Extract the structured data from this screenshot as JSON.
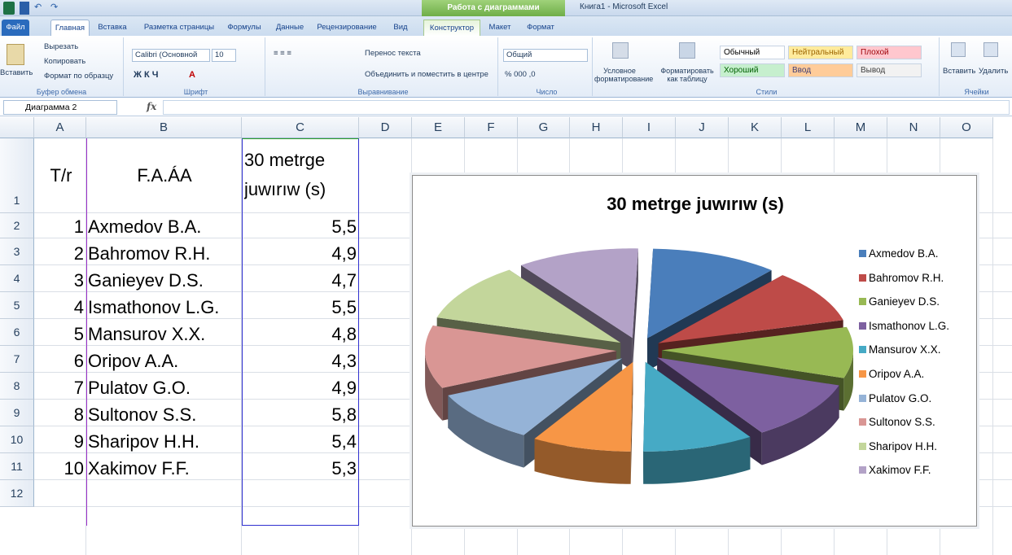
{
  "app": {
    "window_title": "Книга1 - Microsoft Excel",
    "context_tab_group": "Работа с диаграммами"
  },
  "ribbon": {
    "tabs": [
      "Файл",
      "Главная",
      "Вставка",
      "Разметка страницы",
      "Формулы",
      "Данные",
      "Рецензирование",
      "Вид",
      "Конструктор",
      "Макет",
      "Формат"
    ],
    "clipboard": {
      "paste": "Вставить",
      "cut": "Вырезать",
      "copy": "Копировать",
      "format_painter": "Формат по образцу",
      "label": "Буфер обмена"
    },
    "font": {
      "name": "Calibri (Основной",
      "size": "10",
      "label": "Шрифт"
    },
    "alignment": {
      "wrap": "Перенос текста",
      "merge": "Объединить и поместить в центре",
      "label": "Выравнивание"
    },
    "number": {
      "format": "Общий",
      "label": "Число"
    },
    "styles": {
      "conditional": "Условное форматирование",
      "as_table": "Форматировать как таблицу",
      "cells": [
        "Обычный",
        "Нейтральный",
        "Плохой",
        "Хороший",
        "Ввод",
        "Вывод"
      ],
      "label": "Стили"
    },
    "cells_group": {
      "insert": "Вставить",
      "delete": "Удалить",
      "label": "Ячейки"
    }
  },
  "formula_bar": {
    "name_box": "Диаграмма 2",
    "fx": "fx",
    "value": ""
  },
  "sheet": {
    "columns": [
      "A",
      "B",
      "C",
      "D",
      "E",
      "F",
      "G",
      "H",
      "I",
      "J",
      "K",
      "L",
      "M",
      "N",
      "O"
    ],
    "rows": [
      "1",
      "2",
      "3",
      "4",
      "5",
      "6",
      "7",
      "8",
      "9",
      "10",
      "11",
      "12"
    ],
    "header": {
      "a": "T/r",
      "b": "F.A.ÁA",
      "c1": "30 metrge",
      "c2": "juwırıw (s)"
    },
    "data": [
      {
        "n": "1",
        "name": "Axmedov B.A.",
        "val": "5,5"
      },
      {
        "n": "2",
        "name": "Bahromov R.H.",
        "val": "4,9"
      },
      {
        "n": "3",
        "name": "Ganieyev D.S.",
        "val": "4,7"
      },
      {
        "n": "4",
        "name": "Ismathonov L.G.",
        "val": "5,5"
      },
      {
        "n": "5",
        "name": "Mansurov X.X.",
        "val": "4,8"
      },
      {
        "n": "6",
        "name": "Oripov A.A.",
        "val": "4,3"
      },
      {
        "n": "7",
        "name": "Pulatov G.O.",
        "val": "4,9"
      },
      {
        "n": "8",
        "name": "Sultonov S.S.",
        "val": "5,8"
      },
      {
        "n": "9",
        "name": "Sharipov H.H.",
        "val": "5,4"
      },
      {
        "n": "10",
        "name": "Xakimov F.F.",
        "val": "5,3"
      }
    ]
  },
  "chart_data": {
    "type": "pie",
    "title": "30 metrge juwırıw (s)",
    "categories": [
      "Axmedov B.A.",
      "Bahromov R.H.",
      "Ganieyev D.S.",
      "Ismathonov L.G.",
      "Mansurov X.X.",
      "Oripov A.A.",
      "Pulatov G.O.",
      "Sultonov S.S.",
      "Sharipov H.H.",
      "Xakimov F.F."
    ],
    "values": [
      5.5,
      4.9,
      4.7,
      5.5,
      4.8,
      4.3,
      4.9,
      5.8,
      5.4,
      5.3
    ],
    "colors": [
      "#4a7ebb",
      "#be4b48",
      "#98b954",
      "#7d60a0",
      "#46aac5",
      "#f79646",
      "#95b3d7",
      "#d99694",
      "#c3d69b",
      "#b3a2c7"
    ],
    "legend": "right",
    "style": "exploded 3-D pie"
  }
}
